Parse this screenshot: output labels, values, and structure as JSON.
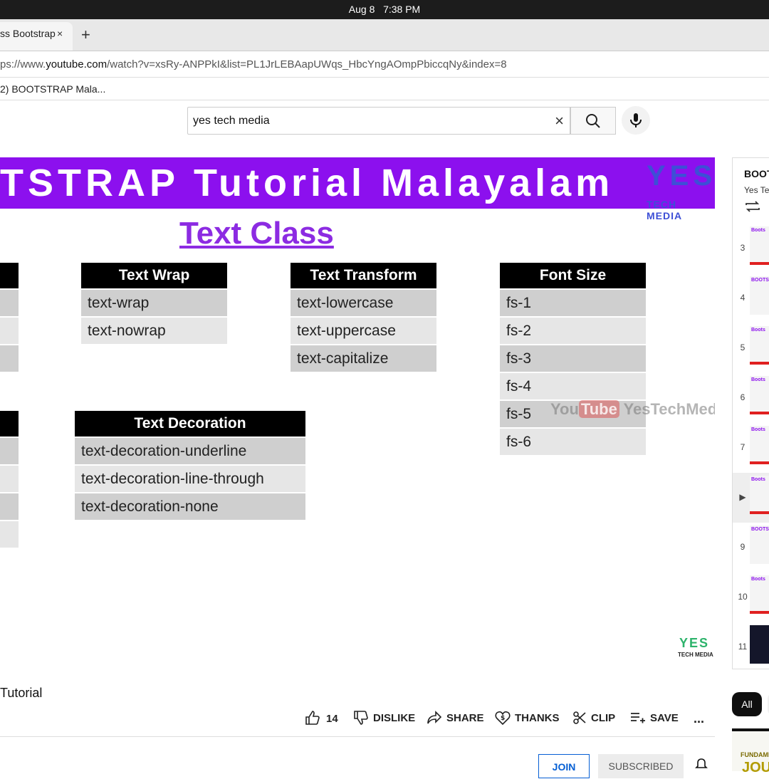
{
  "system": {
    "date": "Aug 8",
    "time": "7:38 PM"
  },
  "browser": {
    "tab_title": "ss Bootstrap",
    "tab_close": "×",
    "new_tab": "+",
    "url_prefix": "ps://www.",
    "url_domain": "youtube.com",
    "url_rest": "/watch?v=xsRy-ANPPkI&list=PL1JrLEBAapUWqs_HbcYngAOmpPbiccqNy&index=8",
    "bookmark": "2) BOOTSTRAP Mala..."
  },
  "search": {
    "value": "yes tech media",
    "clear": "×"
  },
  "video": {
    "banner": "TSTRAP  Tutorial Malayalam",
    "logo_yes": "YES",
    "logo_tech": "TECH MEDIA",
    "heading": "Text Class",
    "tables": {
      "wrap": {
        "header": "Text Wrap",
        "rows": [
          "text-wrap",
          "text-nowrap"
        ]
      },
      "transform": {
        "header": "Text Transform",
        "rows": [
          "text-lowercase",
          "text-uppercase",
          "text-capitalize"
        ]
      },
      "fontsize": {
        "header": "Font Size",
        "rows": [
          "fs-1",
          "fs-2",
          "fs-3",
          "fs-4",
          "fs-5",
          "fs-6"
        ]
      },
      "decoration": {
        "header": "Text Decoration",
        "rows": [
          "text-decoration-underline",
          "text-decoration-line-through",
          "text-decoration-none"
        ]
      }
    },
    "watermark_you": "You",
    "watermark_tube": "Tube",
    "watermark_channel": "YesTechMedia",
    "corner_yes": "YES",
    "corner_tech": "TECH MEDIA"
  },
  "page": {
    "title": "Tutorial",
    "likes": "14",
    "dislike": "DISLIKE",
    "share": "SHARE",
    "thanks": "THANKS",
    "clip": "CLIP",
    "save": "SAVE",
    "more": "...",
    "join": "JOIN",
    "subscribed": "SUBSCRIBED"
  },
  "playlist": {
    "title": "BOOT",
    "channel": "Yes Te",
    "items": [
      {
        "index": "3",
        "label": "Boots"
      },
      {
        "index": "4",
        "label": "BOOTS"
      },
      {
        "index": "5",
        "label": "Boots"
      },
      {
        "index": "6",
        "label": "Boots"
      },
      {
        "index": "7",
        "label": "Boots"
      },
      {
        "index": "▶",
        "label": "Boots"
      },
      {
        "index": "9",
        "label": "BOOTS"
      },
      {
        "index": "10",
        "label": "Boots"
      },
      {
        "index": "11",
        "label": ""
      }
    ],
    "chip_all": "All"
  },
  "recommendation": {
    "line1": "FUNDAME",
    "line2": "JOU"
  }
}
